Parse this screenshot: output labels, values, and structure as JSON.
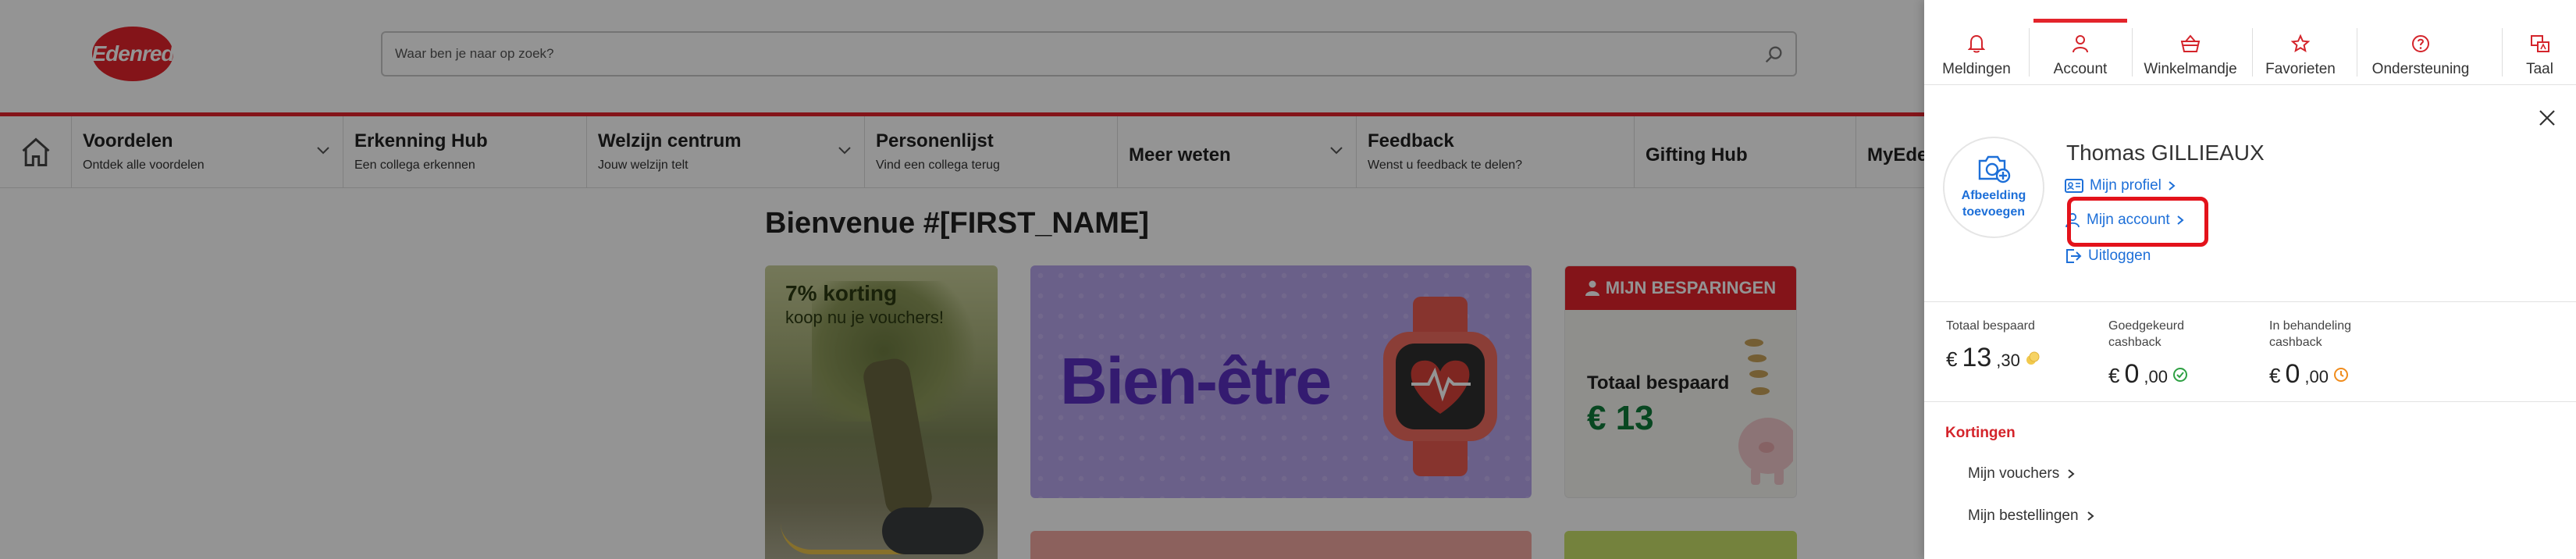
{
  "header": {
    "logo_text": "Edenred",
    "search_placeholder": "Waar ben je naar op zoek?",
    "brand_color": "#e3242b"
  },
  "nav": {
    "items": [
      {
        "title": "Voordelen",
        "subtitle": "Ontdek alle voordelen",
        "has_chevron": true
      },
      {
        "title": "Erkenning Hub",
        "subtitle": "Een collega erkennen",
        "has_chevron": false
      },
      {
        "title": "Welzijn centrum",
        "subtitle": "Jouw welzijn telt",
        "has_chevron": true
      },
      {
        "title": "Personenlijst",
        "subtitle": "Vind een collega terug",
        "has_chevron": false
      },
      {
        "title": "Meer weten",
        "subtitle": "",
        "has_chevron": true
      },
      {
        "title": "Feedback",
        "subtitle": "Wenst u feedback te delen?",
        "has_chevron": false
      },
      {
        "title": "Gifting Hub",
        "subtitle": "",
        "has_chevron": false
      },
      {
        "title": "MyEde",
        "subtitle": "",
        "has_chevron": false
      }
    ]
  },
  "main": {
    "welcome": "Bienvenue #[FIRST_NAME]",
    "promo": {
      "title": "7% korting",
      "subtitle": "koop nu je vouchers!"
    },
    "bien_etre": "Bien-être",
    "savings": {
      "header": "MIJN BESPARINGEN",
      "label": "Totaal bespaard",
      "value": "€ 13"
    }
  },
  "panel": {
    "tabs": [
      {
        "label": "Meldingen",
        "icon": "bell-icon",
        "active": false
      },
      {
        "label": "Account",
        "icon": "user-icon",
        "active": true
      },
      {
        "label": "Winkelmandje",
        "icon": "basket-icon",
        "active": false
      },
      {
        "label": "Favorieten",
        "icon": "star-icon",
        "active": false
      },
      {
        "label": "Ondersteuning",
        "icon": "help-icon",
        "active": false
      },
      {
        "label": "Taal",
        "icon": "language-icon",
        "active": false
      }
    ],
    "avatar_label_1": "Afbeelding",
    "avatar_label_2": "toevoegen",
    "user_name": "Thomas GILLIEAUX",
    "links": {
      "profile": "Mijn profiel",
      "account": "Mijn account",
      "logout": "Uitloggen"
    },
    "stats": [
      {
        "label_1": "Totaal bespaard",
        "label_2": "",
        "currency": "€",
        "whole": "13",
        "cents": ",30",
        "icon": "coins-icon"
      },
      {
        "label_1": "Goedgekeurd",
        "label_2": "cashback",
        "currency": "€",
        "whole": "0",
        "cents": ",00",
        "icon": "check-circle-icon"
      },
      {
        "label_1": "In behandeling",
        "label_2": "cashback",
        "currency": "€",
        "whole": "0",
        "cents": ",00",
        "icon": "clock-icon"
      }
    ],
    "section_title": "Kortingen",
    "sub_links": [
      "Mijn vouchers",
      "Mijn bestellingen"
    ],
    "accent_color": "#d4242b",
    "link_color": "#1d6fd8"
  }
}
